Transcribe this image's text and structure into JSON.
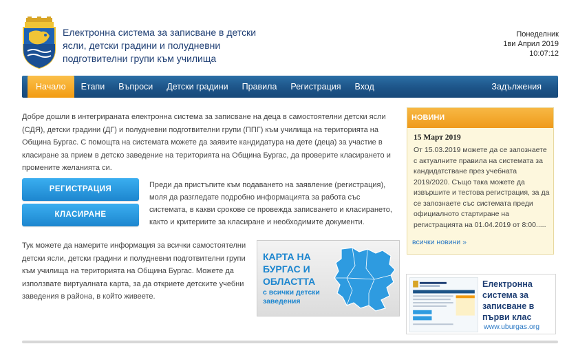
{
  "header": {
    "title": "Електронна система за записване в детски ясли, детски градини и полудневни подготвителни групи към училища",
    "day": "Понеделник",
    "date": "1ви Април 2019",
    "time": "10:07:12"
  },
  "nav": {
    "items": [
      {
        "label": "Начало",
        "active": true
      },
      {
        "label": "Етапи"
      },
      {
        "label": "Въпроси"
      },
      {
        "label": "Детски градини"
      },
      {
        "label": "Правила"
      },
      {
        "label": "Регистрация"
      },
      {
        "label": "Вход"
      }
    ],
    "right": "Задължения"
  },
  "main": {
    "intro": "Добре дошли в интегрираната електронна система за записване на деца в самостоятелни детски ясли (СДЯ), детски градини (ДГ) и полудневни подготвителни групи (ППГ) към училища на територията на Община Бургас. С помощта на системата можете да заявите кандидатура на дете (деца) за участие в класиране за прием в детско заведение на територията на Община Бургас, да проверите класирането и промените желанията си.",
    "register_button": "РЕГИСТРАЦИЯ",
    "ranking_button": "КЛАСИРАНЕ",
    "para2": "Преди да пристъпите към подаването на заявление (регистрация), моля да разгледате подробно информацията за работа със системата, в какви срокове се провежда записването и класирането, както и критериите за класиране и необходимите документи.",
    "para3": "Тук можете да намерите информация за всички самостоятелни детски ясли, детски градини и полудневни подготвителни групи към училища на територията на Община Бургас. Можете да използвате виртуалната карта, за да откриете детските учебни заведения в района, в който живеете.",
    "map_title": "КАРТА НА БУРГАС И ОБЛАСТТА",
    "map_sub": "с всички детски заведения"
  },
  "news": {
    "header": "НОВИНИ",
    "date": "15 Март 2019",
    "text": "От 15.03.2019 можете да се запознаете с актуалните правила на системата за кандидатстване през учебната 2019/2020. Също така можете да извършите и тестова регистрация, за да се запознаете със системата преди официалното стартиране на регистрацията на 01.04.2019 от 8:00.....",
    "more": "всички новини »"
  },
  "school_banner": {
    "title": "Електронна система за записване в първи клас",
    "url": "www.uburgas.org"
  },
  "colors": {
    "nav_blue": "#1d5488",
    "accent_orange": "#f29b12",
    "button_blue": "#1d86cf",
    "title_blue": "#1f3f74"
  }
}
